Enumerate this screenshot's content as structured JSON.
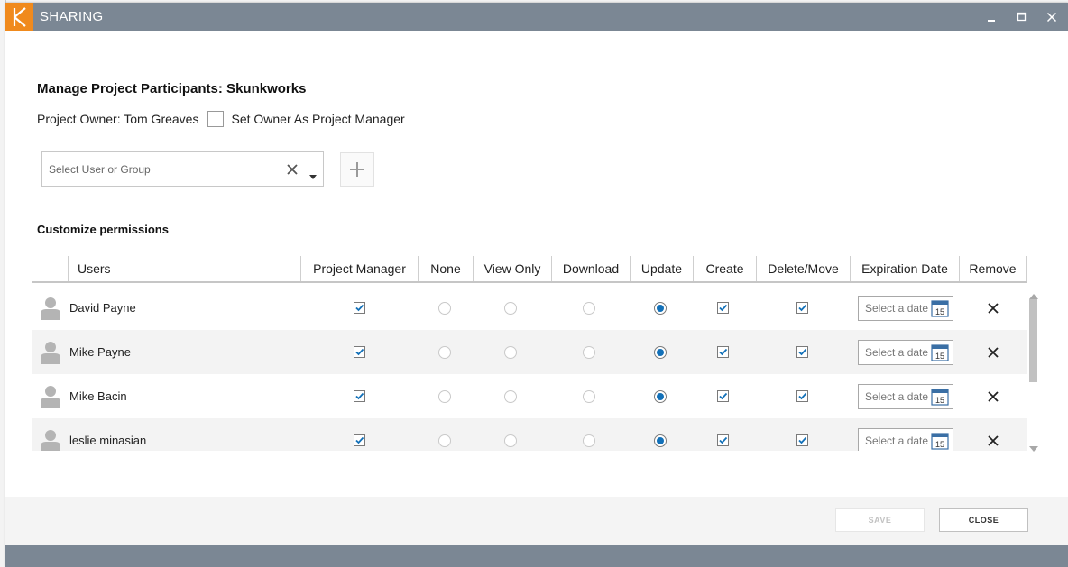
{
  "window": {
    "title": "SHARING",
    "logo_letter": "K",
    "colors": {
      "titlebar": "#7b8794",
      "logo": "#f08a1d",
      "accent": "#1270b8"
    }
  },
  "header": {
    "heading": "Manage Project Participants: Skunkworks",
    "owner_label": "Project Owner: Tom Greaves",
    "set_owner_label": "Set Owner As Project Manager",
    "set_owner_checked": false
  },
  "user_picker": {
    "placeholder": "Select User or Group",
    "clear_icon": "close-icon",
    "dropdown_icon": "chevron-down-icon",
    "add_icon": "plus-icon"
  },
  "permissions": {
    "title": "Customize permissions",
    "columns": [
      "Users",
      "Project Manager",
      "None",
      "View Only",
      "Download",
      "Update",
      "Create",
      "Delete/Move",
      "Expiration Date",
      "Remove"
    ],
    "rows": [
      {
        "name": "David Payne",
        "project_manager": true,
        "access": "Update",
        "create": true,
        "delete_move": true,
        "expiration": "Select a date"
      },
      {
        "name": "Mike Payne",
        "project_manager": true,
        "access": "Update",
        "create": true,
        "delete_move": true,
        "expiration": "Select a date"
      },
      {
        "name": "Mike Bacin",
        "project_manager": true,
        "access": "Update",
        "create": true,
        "delete_move": true,
        "expiration": "Select a date"
      },
      {
        "name": "leslie minasian",
        "project_manager": true,
        "access": "Update",
        "create": true,
        "delete_move": true,
        "expiration": "Select a date"
      }
    ],
    "calendar_icon_day": "15"
  },
  "footer": {
    "save_label": "SAVE",
    "save_enabled": false,
    "close_label": "CLOSE"
  }
}
